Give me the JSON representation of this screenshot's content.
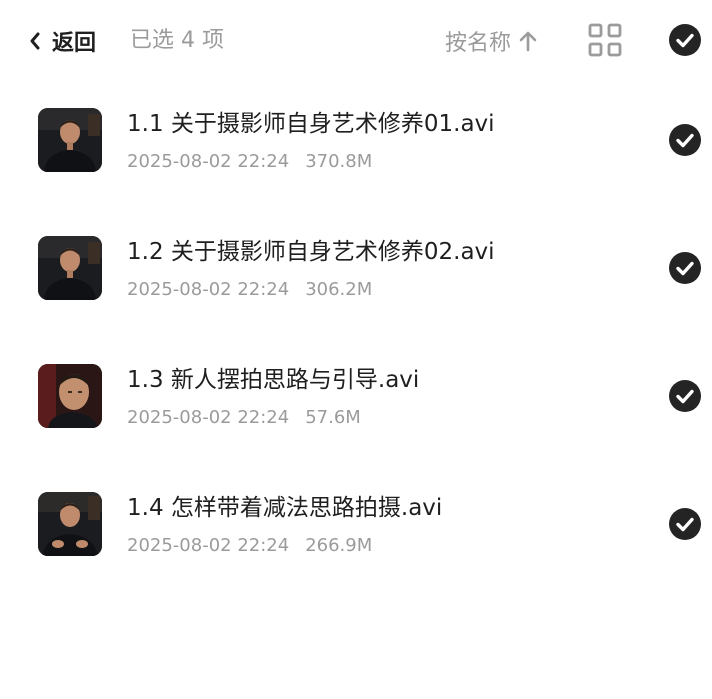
{
  "header": {
    "back_label": "返回",
    "selected_text": "已选 4 项",
    "sort_label": "按名称",
    "sort_icon": "arrow-up-icon",
    "view_icon": "grid-view-icon",
    "select_all_icon": "check-circle-icon"
  },
  "colors": {
    "text_primary": "#1f1f1f",
    "text_secondary": "#9b9b9b",
    "check_fill": "#242424",
    "background": "#ffffff"
  },
  "files": [
    {
      "name": "1.1 关于摄影师自身艺术修养01.avi",
      "date": "2025-08-02 22:24",
      "size": "370.8M",
      "thumbnail": "video-thumbnail-man-dark-shirt",
      "selected": true
    },
    {
      "name": "1.2 关于摄影师自身艺术修养02.avi",
      "date": "2025-08-02 22:24",
      "size": "306.2M",
      "thumbnail": "video-thumbnail-man-dark-shirt",
      "selected": true
    },
    {
      "name": "1.3 新人摆拍思路与引导.avi",
      "date": "2025-08-02 22:24",
      "size": "57.6M",
      "thumbnail": "video-thumbnail-man-closeup",
      "selected": true
    },
    {
      "name": "1.4 怎样带着减法思路拍摄.avi",
      "date": "2025-08-02 22:24",
      "size": "266.9M",
      "thumbnail": "video-thumbnail-man-gesturing",
      "selected": true
    }
  ]
}
